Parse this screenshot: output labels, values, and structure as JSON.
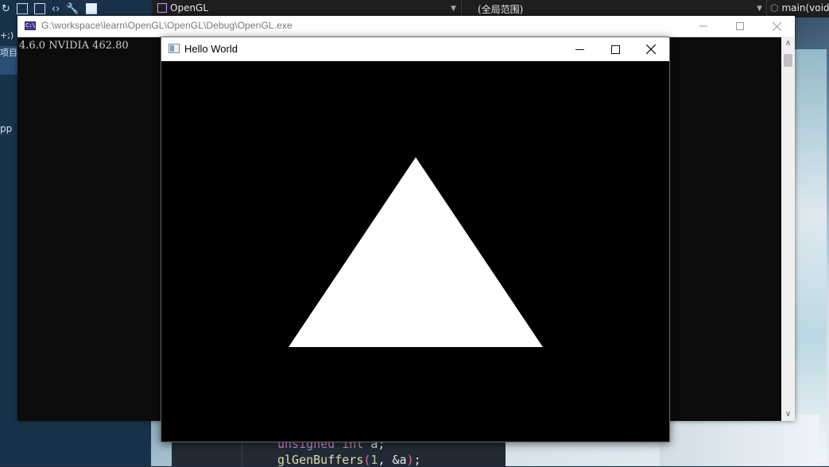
{
  "ide": {
    "project_dropdown": "OpenGL",
    "scope_dropdown": "(全局范围)",
    "member_dropdown": "main(void",
    "sidebar_label_a": "+;)",
    "sidebar_label_b": "项目",
    "sidebar_label_c": "pp",
    "code_lines": [
      {
        "kw": "unsigned int",
        "rest": " a;"
      },
      {
        "fn": "glGenBuffers",
        "open": "(",
        "num": "1",
        "mid": ", &a",
        "close": ")",
        "end": ";"
      }
    ]
  },
  "console": {
    "title": "G:\\workspace\\learn\\OpenGL\\OpenGL\\Debug\\OpenGL.exe",
    "icon_text": "C:\\",
    "output": "4.6.0 NVIDIA 462.80"
  },
  "glwindow": {
    "title": "Hello World",
    "background": "#000000",
    "triangle_color": "#ffffff"
  },
  "icons": {
    "minimize": "minimize-icon",
    "maximize": "maximize-icon",
    "close": "close-icon"
  }
}
